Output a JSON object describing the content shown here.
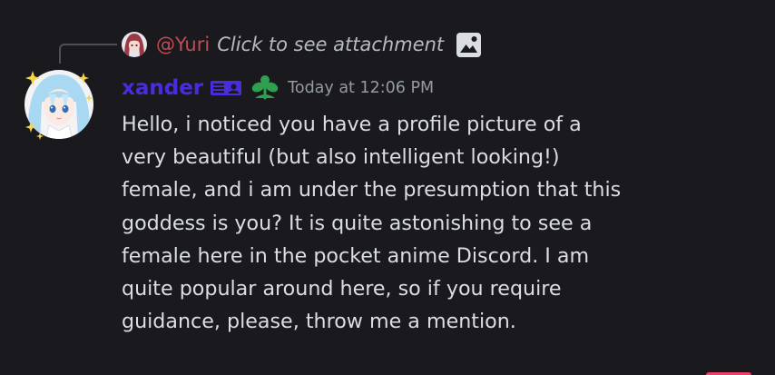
{
  "reply": {
    "author": "@Yuri",
    "preview_text": "Click to see attachment",
    "avatar_icon": "anime-girl-red-hair-avatar",
    "attachment_icon": "image-icon"
  },
  "message": {
    "username": "xander",
    "username_color": "#4b2bdf",
    "tag_badge_icon": "id-card-badge-icon",
    "role_badge_icon": "green-sprout-badge-icon",
    "timestamp": "Today at 12:06 PM",
    "avatar_icon": "anime-girl-light-blue-hair-avatar",
    "body": "Hello, i noticed you have a profile picture of a\nvery beautiful (but also intelligent looking!)\nfemale, and i am under the presumption that this\ngoddess is you? It is quite astonishing to see a\nfemale here in the pocket anime Discord. I am\nquite popular around here, so if you require\nguidance, please, throw me a mention."
  }
}
